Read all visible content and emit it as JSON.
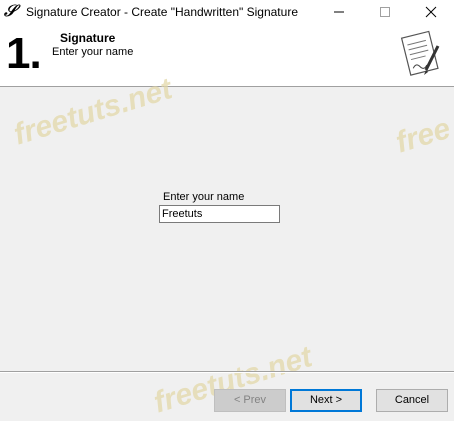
{
  "window": {
    "title": "Signature Creator - Create \"Handwritten\" Signature",
    "app_icon_glyph": "𝒮",
    "controls": [
      "minimize-icon",
      "maximize-icon",
      "close-icon"
    ]
  },
  "header": {
    "step_number": "1.",
    "step_title": "Signature",
    "step_subtitle": "Enter your name",
    "icon": "document-pen-icon"
  },
  "form": {
    "name_label": "Enter your name",
    "name_value": "Freetuts"
  },
  "watermarks": [
    "freetuts.net",
    "free",
    "freetuts.net"
  ],
  "buttons": {
    "prev_label": "< Prev",
    "next_label": "Next >",
    "cancel_label": "Cancel"
  },
  "colors": {
    "focus_accent": "#0078d7",
    "watermark": "#e3d9aa"
  }
}
